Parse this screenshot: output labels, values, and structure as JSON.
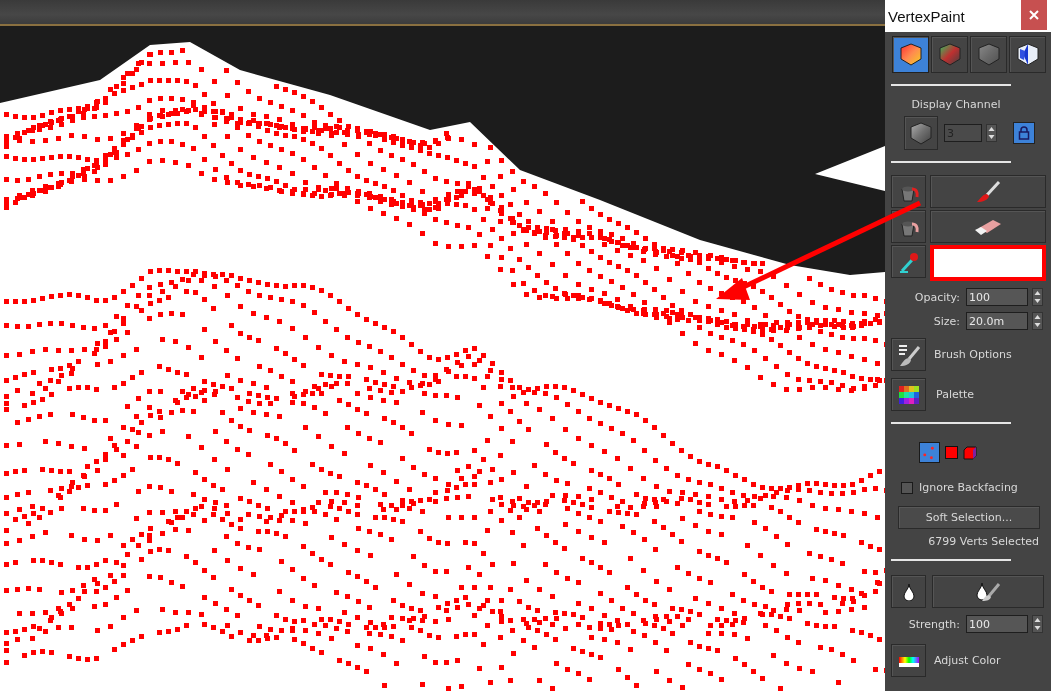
{
  "window": {
    "title": "VertexPaint"
  },
  "mode_buttons": [
    {
      "selected": true
    },
    {
      "selected": false
    },
    {
      "selected": false
    },
    {
      "selected": false
    }
  ],
  "display_channel": {
    "label": "Display Channel",
    "value": "3",
    "lock_on": true
  },
  "paint_swatch": {
    "color": "#ffffff"
  },
  "opacity": {
    "label": "Opacity:",
    "value": "100"
  },
  "size": {
    "label": "Size:",
    "value": "20.0m"
  },
  "brush_options": {
    "label": "Brush Options"
  },
  "palette": {
    "label": "Palette"
  },
  "selection_modes": [
    {
      "selected": true
    },
    {
      "selected": false
    },
    {
      "selected": false
    }
  ],
  "ignore_backfacing": {
    "label": "Ignore Backfacing",
    "checked": false
  },
  "soft_selection_button": "Soft Selection...",
  "selection_count": "6799 Verts Selected",
  "strength": {
    "label": "Strength:",
    "value": "100"
  },
  "adjust_color": {
    "label": "Adjust Color"
  }
}
